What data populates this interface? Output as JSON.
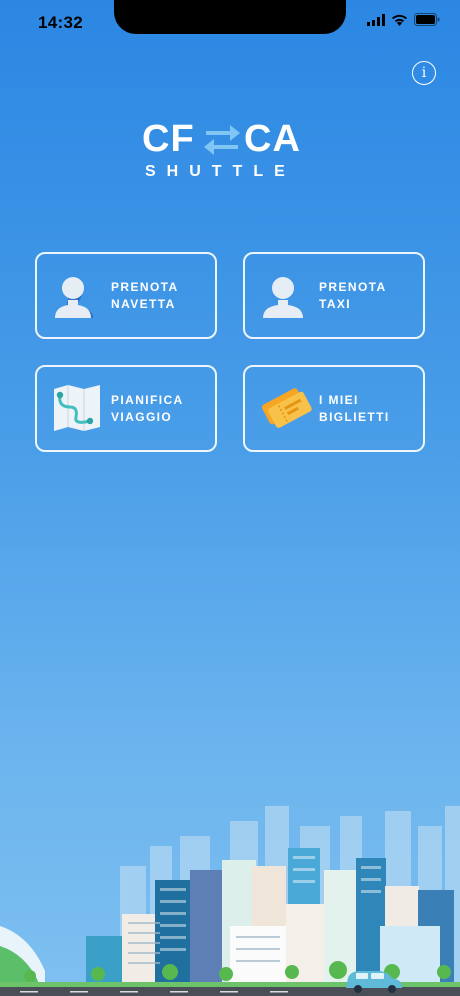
{
  "status_bar": {
    "time": "14:32"
  },
  "header": {
    "info_label": "i"
  },
  "logo": {
    "line1_left": "CF",
    "line1_right": "CA",
    "line2": "SHUTTLE"
  },
  "tiles": [
    {
      "label": "PRENOTA\nNAVETTA",
      "icon": "shuttle-user-icon"
    },
    {
      "label": "PRENOTA\nTAXI",
      "icon": "taxi-user-icon"
    },
    {
      "label": "PIANIFICA\nVIAGGIO",
      "icon": "map-icon"
    },
    {
      "label": "I MIEI\nBIGLIETTI",
      "icon": "tickets-icon"
    }
  ],
  "colors": {
    "background_top": "#2b87e3",
    "background_bottom": "#7ec0f0",
    "accent": "#ffffff"
  }
}
